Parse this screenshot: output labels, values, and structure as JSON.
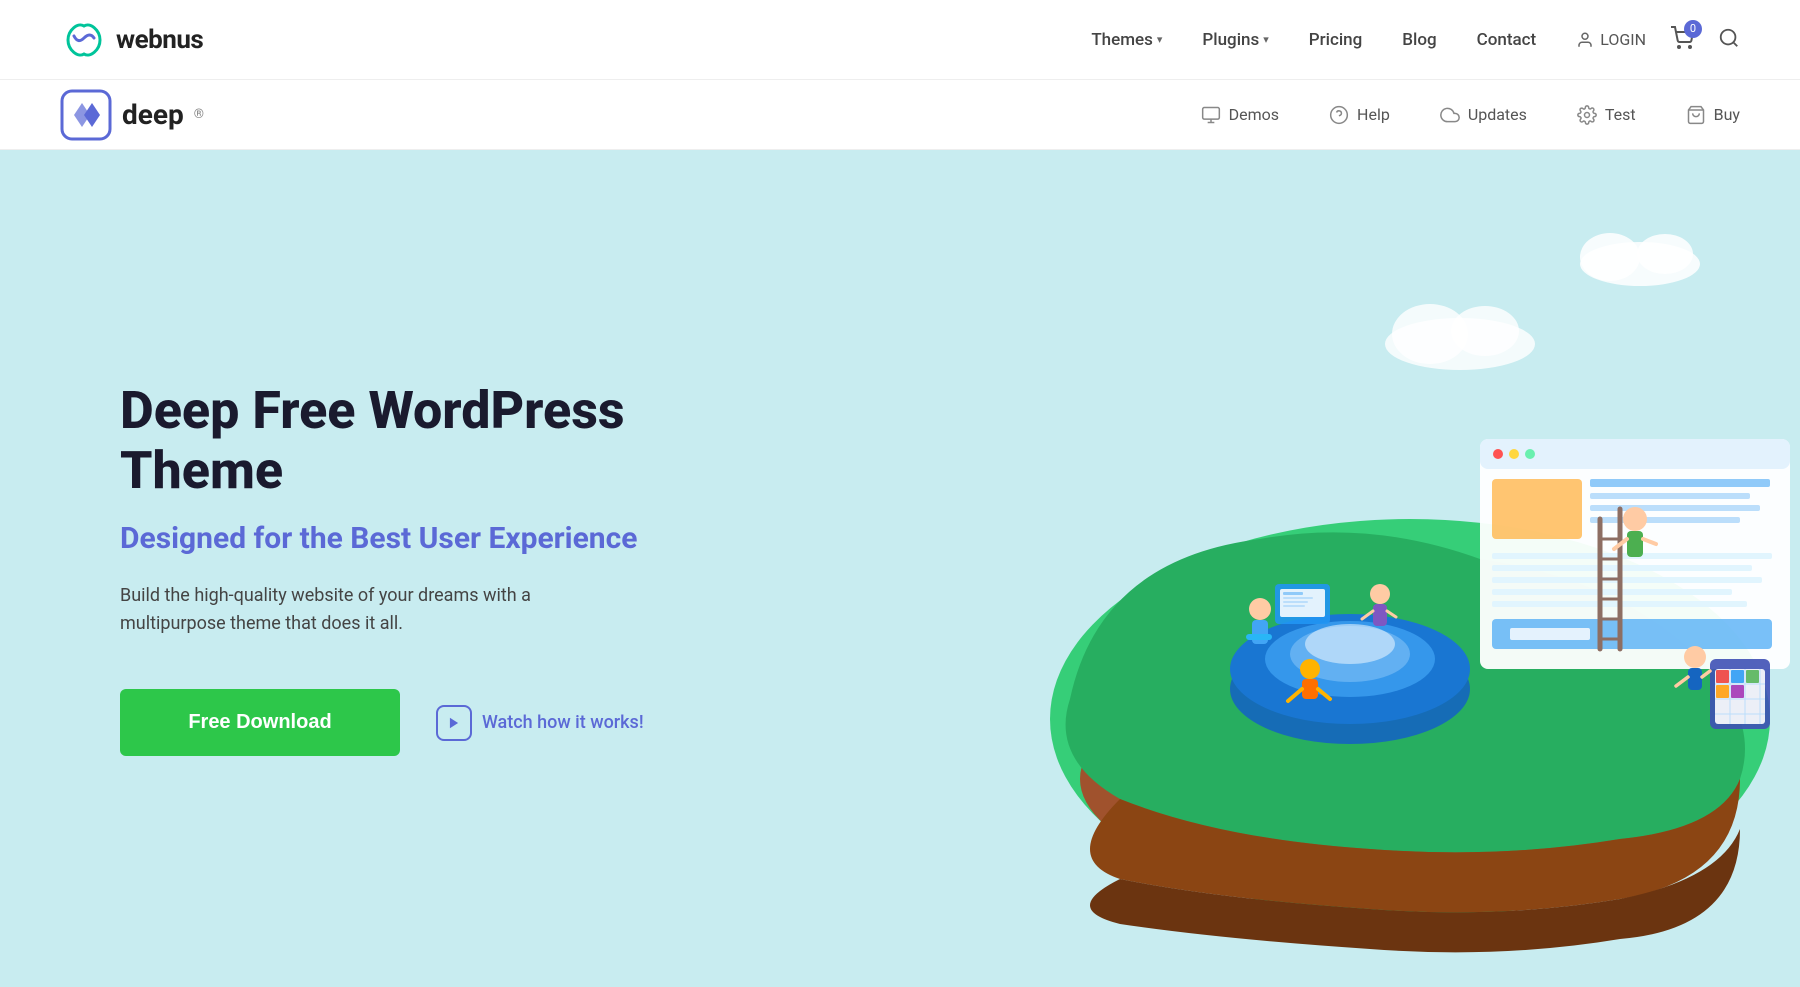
{
  "brand": {
    "name": "webnus",
    "logo_alt": "webnus logo"
  },
  "top_nav": {
    "links": [
      {
        "label": "Themes",
        "has_dropdown": true,
        "id": "themes"
      },
      {
        "label": "Plugins",
        "has_dropdown": true,
        "id": "plugins"
      },
      {
        "label": "Pricing",
        "has_dropdown": false,
        "id": "pricing"
      },
      {
        "label": "Blog",
        "has_dropdown": false,
        "id": "blog"
      },
      {
        "label": "Contact",
        "has_dropdown": false,
        "id": "contact"
      }
    ],
    "login_label": "LOGIN",
    "cart_count": "0"
  },
  "sub_header": {
    "deep_logo_text": "deep",
    "deep_logo_sup": "®",
    "nav_items": [
      {
        "label": "Demos",
        "icon": "monitor",
        "id": "demos"
      },
      {
        "label": "Help",
        "icon": "question-circle",
        "id": "help"
      },
      {
        "label": "Updates",
        "icon": "cloud",
        "id": "updates"
      },
      {
        "label": "Test",
        "icon": "gear",
        "id": "test"
      },
      {
        "label": "Buy",
        "icon": "bag",
        "id": "buy"
      }
    ]
  },
  "hero": {
    "title": "Deep Free WordPress Theme",
    "subtitle": "Designed for the Best User Experience",
    "description": "Build the high-quality website of your dreams with a multipurpose theme that does it all.",
    "btn_download": "Free Download",
    "btn_watch": "Watch how it works!"
  }
}
